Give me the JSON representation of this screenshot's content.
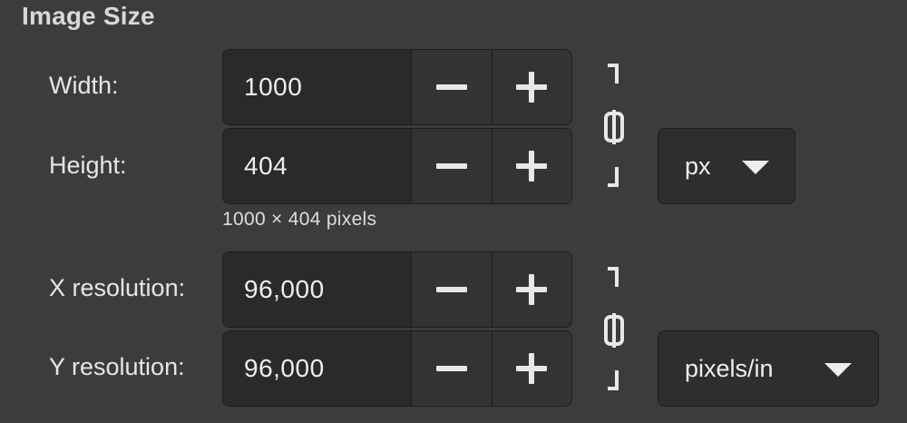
{
  "section": {
    "title": "Image Size"
  },
  "size": {
    "width_label": "Width:",
    "width_value": "1000",
    "height_label": "Height:",
    "height_value": "404",
    "summary": "1000 × 404 pixels",
    "unit": "px",
    "chain_linked": true
  },
  "resolution": {
    "x_label": "X resolution:",
    "x_value": "96,000",
    "y_label": "Y resolution:",
    "y_value": "96,000",
    "unit": "pixels/in",
    "chain_linked": true
  },
  "icons": {
    "decrement": "minus-icon",
    "increment": "plus-icon",
    "chain": "chain-link-icon",
    "dropdown": "triangle-down-icon"
  },
  "colors": {
    "background": "#3c3c3c",
    "field": "#2a2a2a",
    "button": "#333333",
    "text": "#e8e8e8"
  }
}
